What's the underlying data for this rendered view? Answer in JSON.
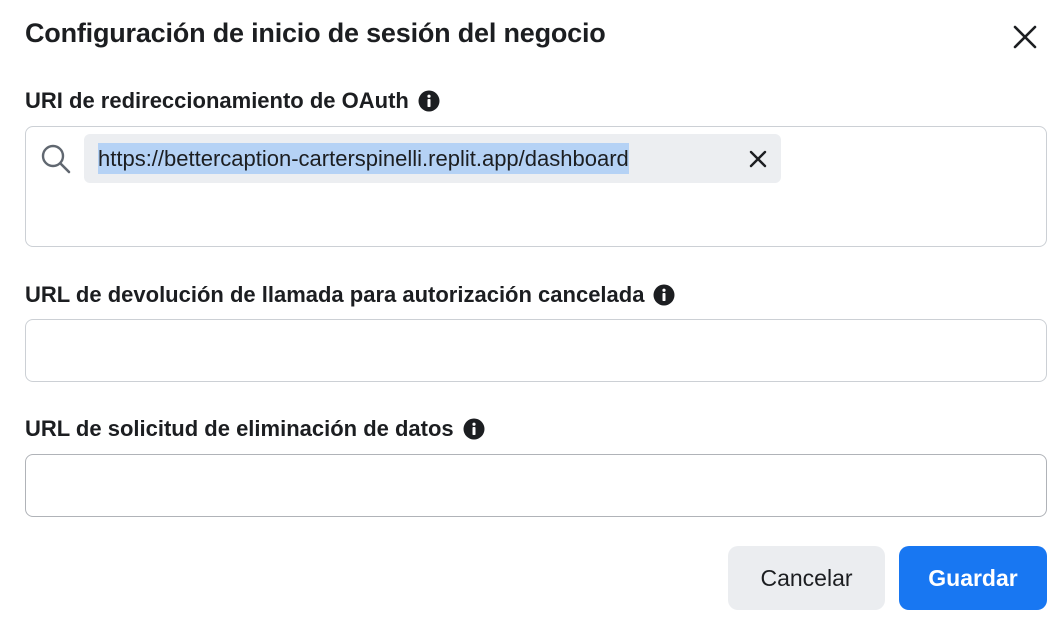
{
  "dialog": {
    "title": "Configuración de inicio de sesión del negocio",
    "close_icon": "close-icon"
  },
  "fields": {
    "oauth_redirect": {
      "label": "URI de redireccionamiento de OAuth",
      "info_icon": "info-icon",
      "search_icon": "search-icon",
      "tokens": [
        "https://bettercaption-carterspinelli.replit.app/dashboard"
      ],
      "token_remove_icon": "close-icon"
    },
    "deauth_callback": {
      "label": "URL de devolución de llamada para autorización cancelada",
      "info_icon": "info-icon",
      "value": ""
    },
    "data_deletion": {
      "label": "URL de solicitud de eliminación de datos",
      "info_icon": "info-icon",
      "value": ""
    }
  },
  "actions": {
    "cancel_label": "Cancelar",
    "save_label": "Guardar"
  },
  "colors": {
    "primary": "#1877f2",
    "secondary_button": "#ebedf0",
    "selection": "#b5d2f5",
    "border": "#ccd0d5",
    "text": "#1c1e21"
  }
}
